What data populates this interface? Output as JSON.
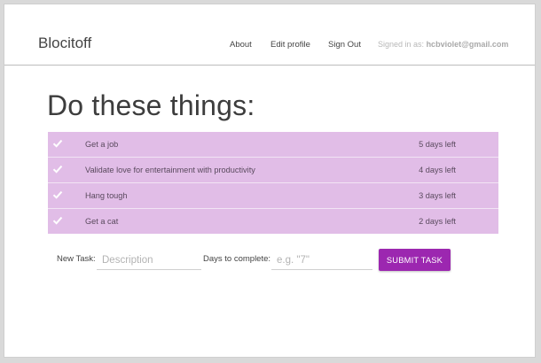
{
  "navbar": {
    "brand": "Blocitoff",
    "links": [
      "About",
      "Edit profile",
      "Sign Out"
    ],
    "signed_in_label": "Signed in as:",
    "signed_in_email": "hcbviolet@gmail.com"
  },
  "main": {
    "title": "Do these things:",
    "tasks": [
      {
        "description": "Get a job",
        "days_left": "5 days left"
      },
      {
        "description": "Validate love for entertainment with productivity",
        "days_left": "4 days left"
      },
      {
        "description": "Hang tough",
        "days_left": "3 days left"
      },
      {
        "description": "Get a cat",
        "days_left": "2 days left"
      }
    ]
  },
  "form": {
    "new_task_label": "New Task:",
    "description_placeholder": "Description",
    "days_label": "Days to complete:",
    "days_placeholder": "e.g. \"7\"",
    "submit_label": "SUBMIT TASK"
  },
  "colors": {
    "accent": "#9c27b0",
    "task_row_bg": "#e1bde7"
  },
  "icons": {
    "complete": "check-icon"
  }
}
